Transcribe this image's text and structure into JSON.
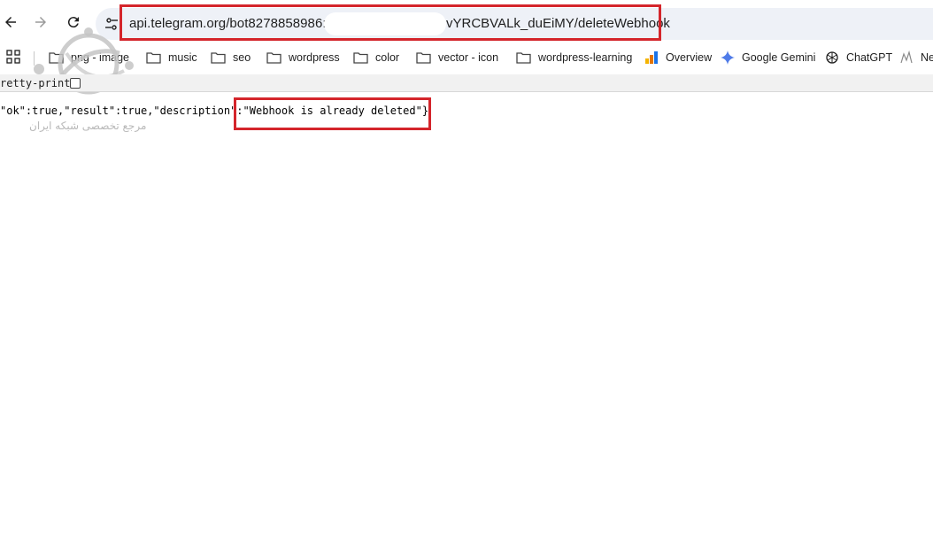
{
  "toolbar": {
    "url_visible_prefix": "api.telegram.org/bot8278858986:AA",
    "url_visible_suffix": "vYRCBVALk_duEiMY/deleteWebhook"
  },
  "bookmarks": [
    {
      "label": "png - image",
      "icon": "folder-icon"
    },
    {
      "label": "music",
      "icon": "folder-icon"
    },
    {
      "label": "seo",
      "icon": "folder-icon"
    },
    {
      "label": "wordpress",
      "icon": "folder-icon"
    },
    {
      "label": "color",
      "icon": "folder-icon"
    },
    {
      "label": "vector - icon",
      "icon": "folder-icon"
    },
    {
      "label": "wordpress-learning",
      "icon": "folder-icon"
    },
    {
      "label": "Overview",
      "icon": "analytics-icon"
    },
    {
      "label": "Google Gemini",
      "icon": "gemini-icon"
    },
    {
      "label": "ChatGPT",
      "icon": "chatgpt-icon"
    },
    {
      "label": "Ne",
      "icon": "site-icon"
    }
  ],
  "pretty_print": {
    "label": "retty-print"
  },
  "json_body": {
    "prefix": "\"ok\":true,\"result\":true,\"description\":",
    "description_value": "\"Webhook is already deleted\"",
    "suffix": "}"
  },
  "watermark": {
    "text": "مرجع تخصصی شبکه ایران"
  },
  "colors": {
    "highlight_box": "#d4252b",
    "omnibox_bg": "#eef1f7"
  }
}
